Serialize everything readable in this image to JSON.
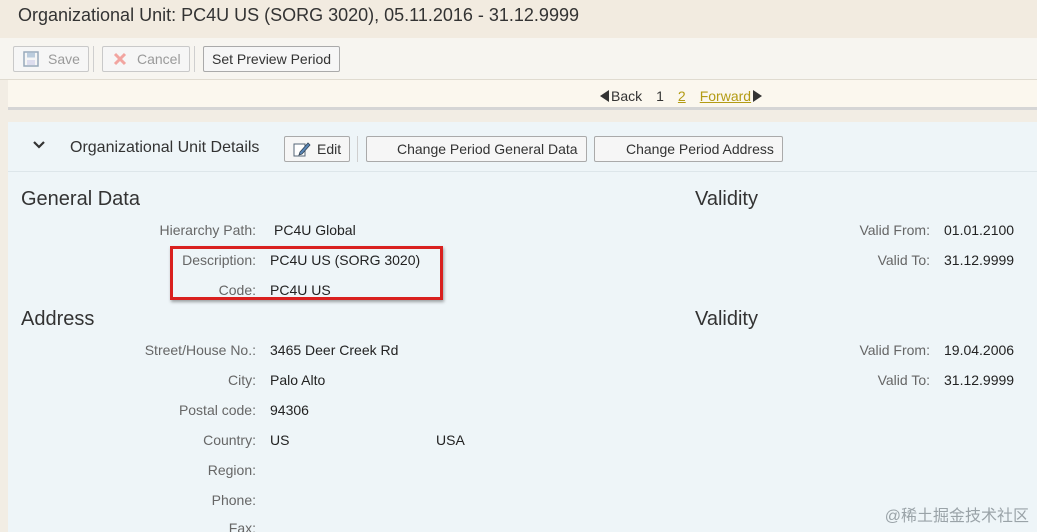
{
  "window": {
    "title": "Organizational Unit: PC4U US (SORG 3020), 05.11.2016 - 31.12.9999"
  },
  "toolbar": {
    "save_label": "Save",
    "cancel_label": "Cancel",
    "preview_label": "Set Preview Period"
  },
  "pager": {
    "back_label": "Back",
    "page1": "1",
    "page2": "2",
    "forward_label": "Forward"
  },
  "details": {
    "section_title": "Organizational Unit Details",
    "edit_label": "Edit",
    "change_general_label": "Change Period General Data",
    "change_address_label": "Change Period Address"
  },
  "general": {
    "title": "General Data",
    "hierarchy_label": "Hierarchy Path:",
    "hierarchy_value": "PC4U Global",
    "description_label": "Description:",
    "description_value": "PC4U US (SORG 3020)",
    "code_label": "Code:",
    "code_value": "PC4U US"
  },
  "general_validity": {
    "title": "Validity",
    "from_label": "Valid From:",
    "from_value": "01.01.2100",
    "to_label": "Valid To:",
    "to_value": "31.12.9999"
  },
  "address": {
    "title": "Address",
    "street_label": "Street/House No.:",
    "street_value": "3465 Deer Creek Rd",
    "city_label": "City:",
    "city_value": "Palo Alto",
    "postal_label": "Postal code:",
    "postal_value": "94306",
    "country_label": "Country:",
    "country_code": "US",
    "country_name": "USA",
    "region_label": "Region:",
    "phone_label": "Phone:",
    "fax_label": "Fax:"
  },
  "address_validity": {
    "title": "Validity",
    "from_label": "Valid From:",
    "from_value": "19.04.2006",
    "to_label": "Valid To:",
    "to_value": "31.12.9999"
  },
  "watermark": "@稀土掘金技术社区",
  "colors": {
    "highlight": "#d9201f",
    "link": "#b39b14",
    "content_bg": "#eef5f8"
  }
}
